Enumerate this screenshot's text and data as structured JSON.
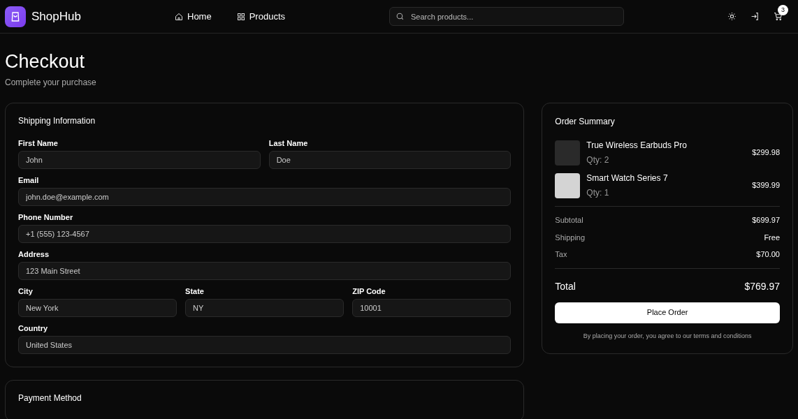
{
  "header": {
    "brand": "ShopHub",
    "nav": [
      {
        "label": "Home",
        "kind": "home"
      },
      {
        "label": "Products",
        "kind": "grid"
      }
    ],
    "search": {
      "placeholder": "Search products..."
    },
    "cart_count": "3"
  },
  "page": {
    "title": "Checkout",
    "subtitle": "Complete your purchase"
  },
  "shipping": {
    "title": "Shipping Information",
    "rows": [
      [
        {
          "label": "First Name",
          "value": "John"
        },
        {
          "label": "Last Name",
          "value": "Doe"
        }
      ],
      [
        {
          "label": "Email",
          "value": "john.doe@example.com"
        }
      ],
      [
        {
          "label": "Phone Number",
          "value": "+1 (555) 123-4567"
        }
      ],
      [
        {
          "label": "Address",
          "value": "123 Main Street"
        }
      ],
      [
        {
          "label": "City",
          "value": "New York"
        },
        {
          "label": "State",
          "value": "NY"
        },
        {
          "label": "ZIP Code",
          "value": "10001"
        }
      ],
      [
        {
          "label": "Country",
          "value": "United States"
        }
      ]
    ]
  },
  "payment": {
    "title": "Payment Method"
  },
  "summary": {
    "title": "Order Summary",
    "items": [
      {
        "name": "True Wireless Earbuds Pro",
        "qty": "Qty: 2",
        "price": "$299.98"
      },
      {
        "name": "Smart Watch Series 7",
        "qty": "Qty: 1",
        "price": "$399.99"
      }
    ],
    "lines": [
      {
        "label": "Subtotal",
        "value": "$699.97"
      },
      {
        "label": "Shipping",
        "value": "Free"
      },
      {
        "label": "Tax",
        "value": "$70.00"
      }
    ],
    "total": {
      "label": "Total",
      "value": "$769.97"
    },
    "button": "Place Order",
    "note": "By placing your order, you agree to our terms and conditions"
  }
}
